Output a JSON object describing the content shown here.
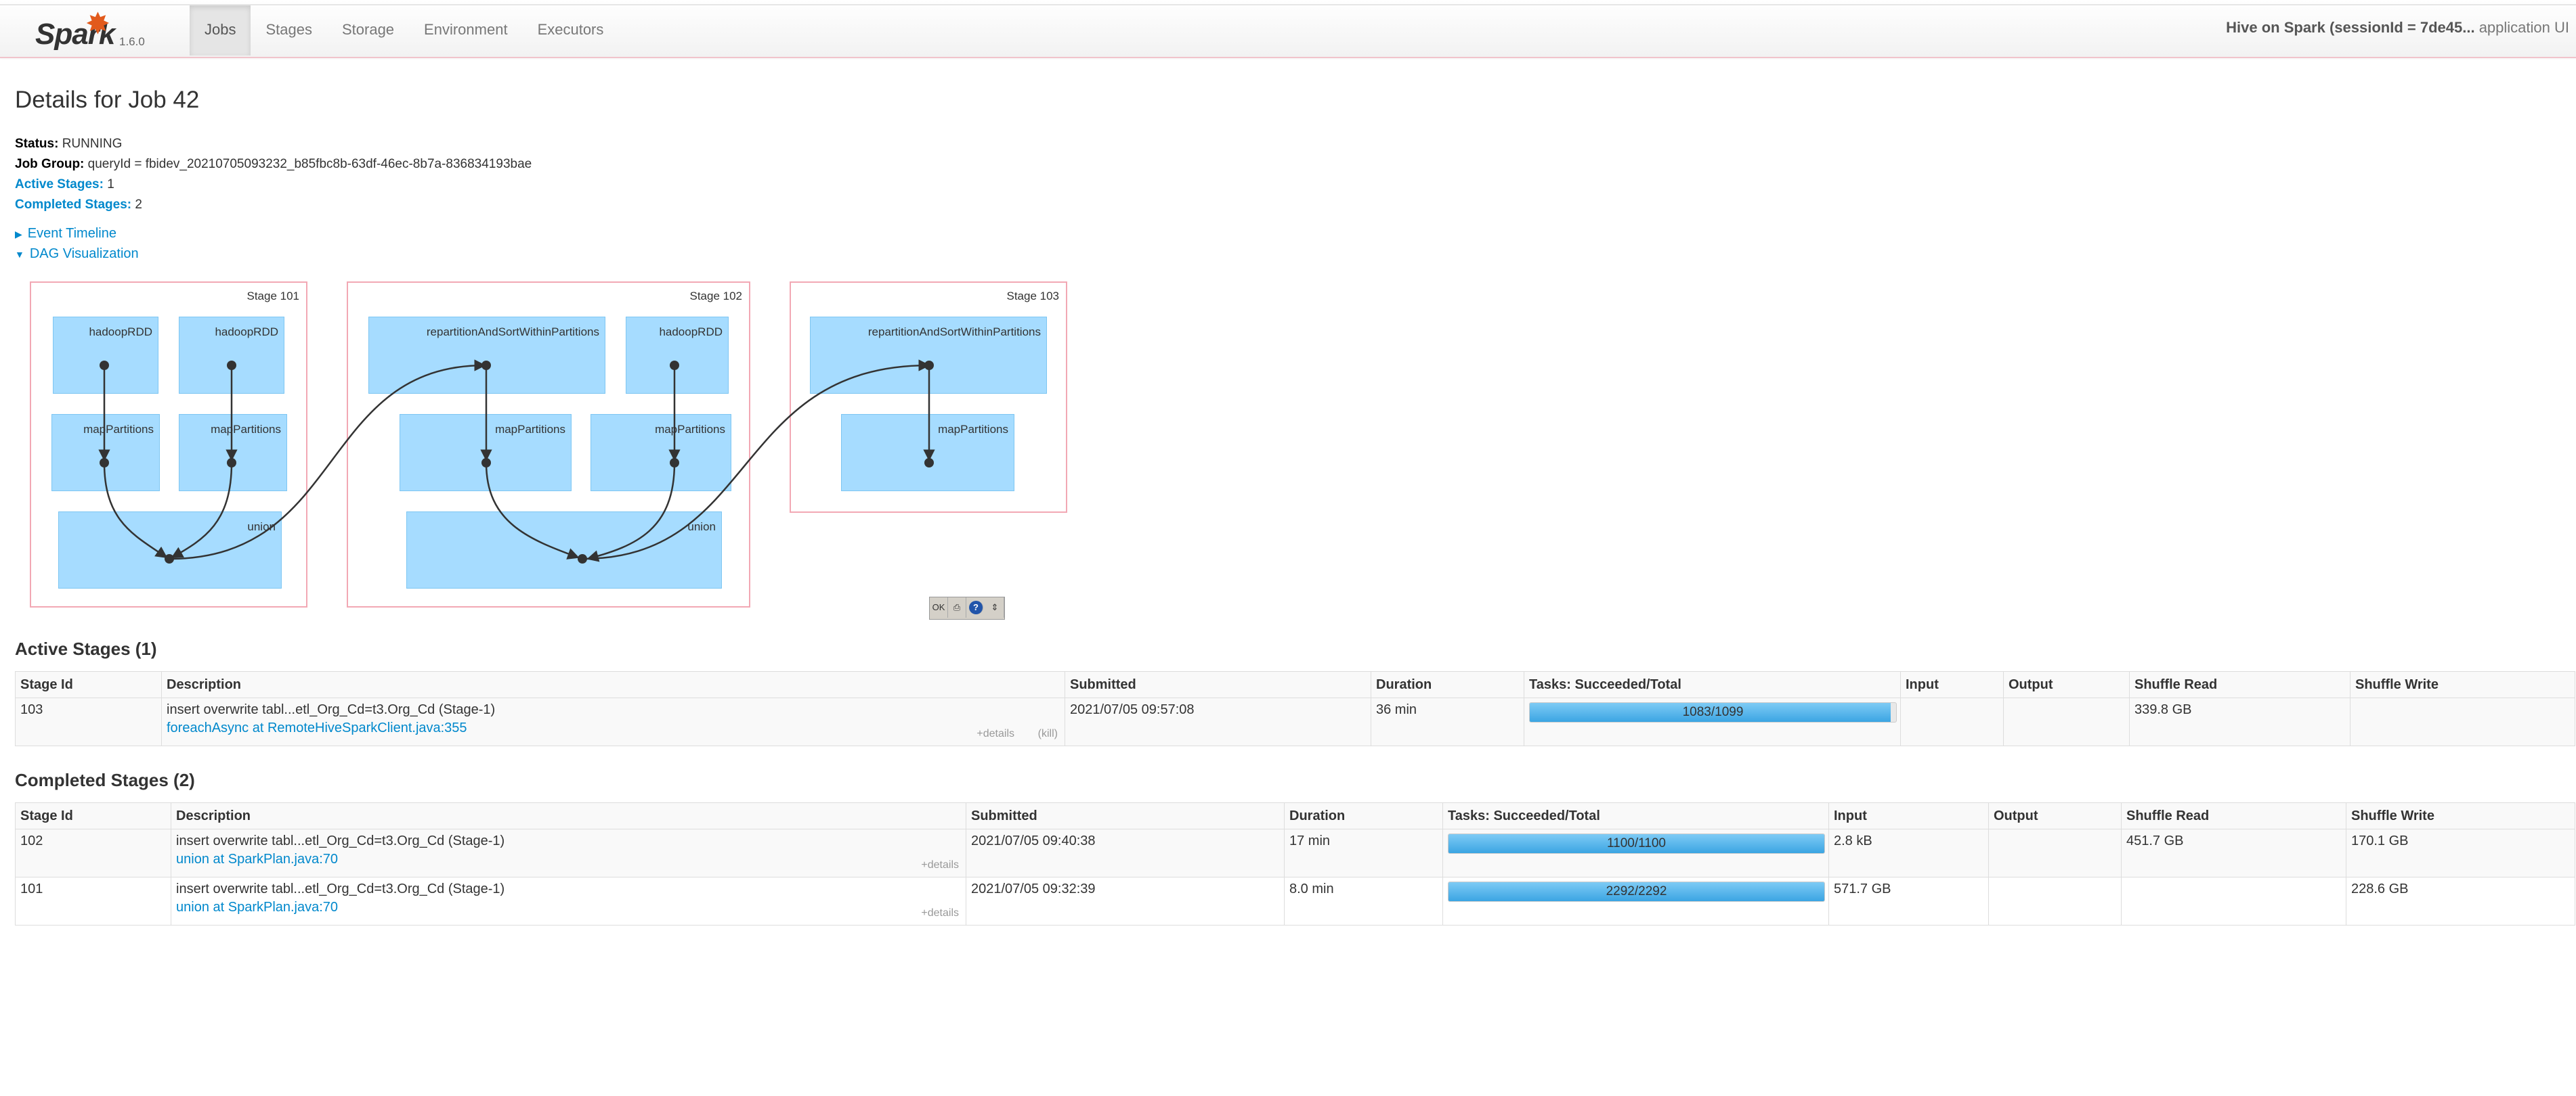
{
  "nav": {
    "brand": "Spark",
    "version": "1.6.0",
    "tabs": [
      {
        "label": "Jobs",
        "active": true
      },
      {
        "label": "Stages"
      },
      {
        "label": "Storage"
      },
      {
        "label": "Environment"
      },
      {
        "label": "Executors"
      }
    ],
    "app_name_bold": "Hive on Spark (sessionId = 7de45...",
    "app_name_suffix": " application UI"
  },
  "page_title": "Details for Job 42",
  "summary": {
    "status_label": "Status:",
    "status_value": "RUNNING",
    "job_group_label": "Job Group:",
    "job_group_value": "queryId = fbidev_20210705093232_b85fbc8b-63df-46ec-8b7a-836834193bae",
    "active_stages_label": "Active Stages:",
    "active_stages_value": "1",
    "completed_stages_label": "Completed Stages:",
    "completed_stages_value": "2"
  },
  "toggles": {
    "event_timeline": "Event Timeline",
    "dag_visualization": "DAG Visualization"
  },
  "dag": {
    "stages": [
      {
        "title": "Stage 101",
        "rdds": [
          "hadoopRDD",
          "hadoopRDD",
          "mapPartitions",
          "mapPartitions",
          "union"
        ]
      },
      {
        "title": "Stage 102",
        "rdds": [
          "repartitionAndSortWithinPartitions",
          "hadoopRDD",
          "mapPartitions",
          "mapPartitions",
          "union"
        ]
      },
      {
        "title": "Stage 103",
        "rdds": [
          "repartitionAndSortWithinPartitions",
          "mapPartitions"
        ]
      }
    ],
    "tools": {
      "ok": "OK",
      "print": "print-icon",
      "help": "?"
    }
  },
  "active": {
    "heading": "Active Stages (1)",
    "columns": [
      "Stage Id",
      "Description",
      "Submitted",
      "Duration",
      "Tasks: Succeeded/Total",
      "Input",
      "Output",
      "Shuffle Read",
      "Shuffle Write"
    ],
    "rows": [
      {
        "id": "103",
        "desc": "insert overwrite tabl...etl_Org_Cd=t3.Org_Cd (Stage-1)",
        "link": "foreachAsync at RemoteHiveSparkClient.java:355",
        "details": "+details",
        "kill": "(kill)",
        "submitted": "2021/07/05 09:57:08",
        "duration": "36 min",
        "tasks": "1083/1099",
        "progress": 0.9854,
        "input": "",
        "output": "",
        "shuffle_read": "339.8 GB",
        "shuffle_write": ""
      }
    ]
  },
  "completed": {
    "heading": "Completed Stages (2)",
    "columns": [
      "Stage Id",
      "Description",
      "Submitted",
      "Duration",
      "Tasks: Succeeded/Total",
      "Input",
      "Output",
      "Shuffle Read",
      "Shuffle Write"
    ],
    "rows": [
      {
        "id": "102",
        "desc": "insert overwrite tabl...etl_Org_Cd=t3.Org_Cd (Stage-1)",
        "link": "union at SparkPlan.java:70",
        "details": "+details",
        "submitted": "2021/07/05 09:40:38",
        "duration": "17 min",
        "tasks": "1100/1100",
        "progress": 1.0,
        "input": "2.8 kB",
        "output": "",
        "shuffle_read": "451.7 GB",
        "shuffle_write": "170.1 GB"
      },
      {
        "id": "101",
        "desc": "insert overwrite tabl...etl_Org_Cd=t3.Org_Cd (Stage-1)",
        "link": "union at SparkPlan.java:70",
        "details": "+details",
        "submitted": "2021/07/05 09:32:39",
        "duration": "8.0 min",
        "tasks": "2292/2292",
        "progress": 1.0,
        "input": "571.7 GB",
        "output": "",
        "shuffle_read": "",
        "shuffle_write": "228.6 GB"
      }
    ]
  }
}
